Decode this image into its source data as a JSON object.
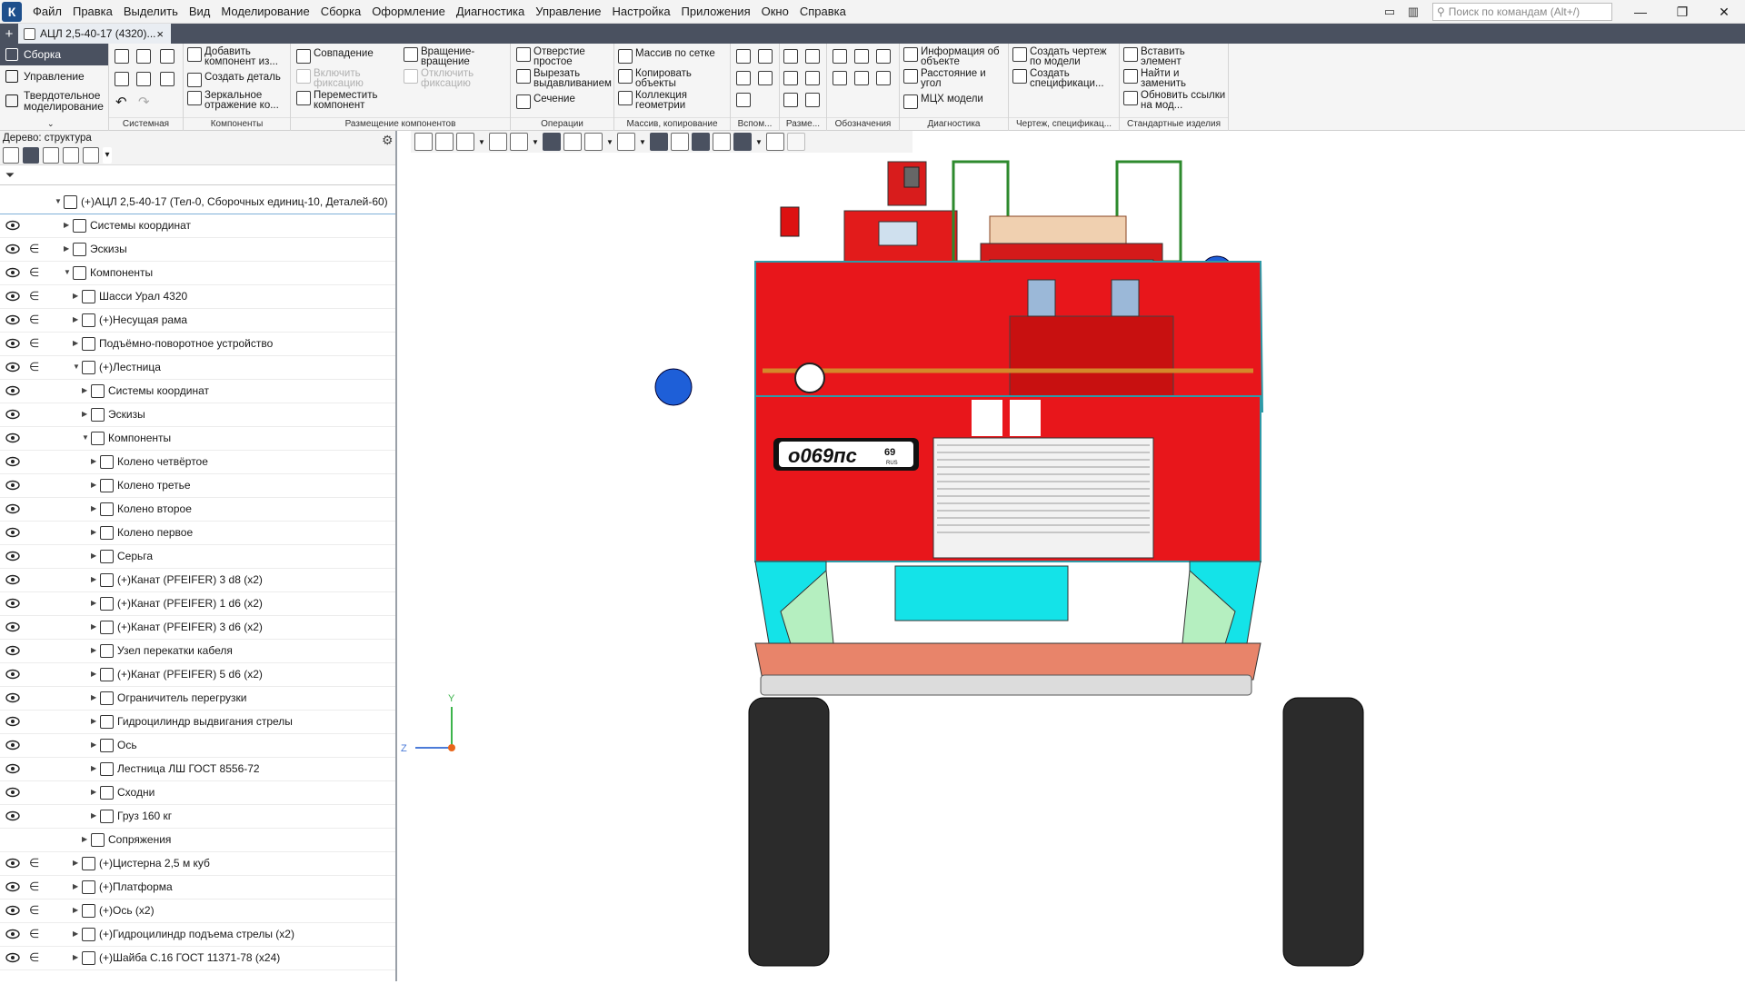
{
  "app": {
    "menu": [
      "Файл",
      "Правка",
      "Выделить",
      "Вид",
      "Моделирование",
      "Сборка",
      "Оформление",
      "Диагностика",
      "Управление",
      "Настройка",
      "Приложения",
      "Окно",
      "Справка"
    ],
    "search_placeholder": "Поиск по командам (Alt+/)"
  },
  "tab": {
    "title": "АЦЛ 2,5-40-17 (4320)...",
    "close": "×",
    "new": "+"
  },
  "ribbon": {
    "modes": [
      "Сборка",
      "Управление",
      "Твердотельное моделирование"
    ],
    "groups": {
      "system": "Системная",
      "components": "Компоненты",
      "placement": "Размещение компонентов",
      "operations": "Операции",
      "array": "Массив, копирование",
      "aux": "Вспом...",
      "dims": "Разме...",
      "marks": "Обозначения",
      "diag": "Диагностика",
      "drawing": "Чертеж, спецификац...",
      "std": "Стандартные изделия"
    },
    "buttons": {
      "add_component": "Добавить компонент из...",
      "create_part": "Создать деталь",
      "mirror": "Зеркальное отражение ко...",
      "coincidence": "Совпадение",
      "include_fix": "Включить фиксацию",
      "move_component": "Переместить компонент",
      "rotation": "Вращение-вращение",
      "disable_fix": "Отключить фиксацию",
      "hole": "Отверстие простое",
      "cut_extrude": "Вырезать выдавливанием",
      "section": "Сечение",
      "array_grid": "Массив по сетке",
      "copy_objects": "Копировать объекты",
      "geom_collection": "Коллекция геометрии",
      "info_object": "Информация об объекте",
      "dist_angle": "Расстояние и угол",
      "mch_model": "МЦХ модели",
      "create_drawing": "Создать чертеж по модели",
      "create_spec": "Создать спецификаци...",
      "insert_element": "Вставить элемент",
      "find_replace": "Найти и заменить",
      "update_links": "Обновить ссылки на мод..."
    }
  },
  "tree": {
    "title": "Дерево: структура",
    "search_placeholder": "",
    "rows": [
      {
        "label": "(+)АЦЛ 2,5-40-17 (Тел-0, Сборочных единиц-10, Деталей-60)",
        "level": 0,
        "eye": false,
        "inc": false
      },
      {
        "label": "Системы координат",
        "level": 1,
        "eye": true,
        "inc": false
      },
      {
        "label": "Эскизы",
        "level": 1,
        "eye": true,
        "inc": true
      },
      {
        "label": "Компоненты",
        "level": 1,
        "eye": true,
        "inc": true,
        "open": true
      },
      {
        "label": "Шасси Урал 4320",
        "level": 2,
        "eye": true,
        "inc": true
      },
      {
        "label": "(+)Несущая рама",
        "level": 2,
        "eye": true,
        "inc": true
      },
      {
        "label": "Подъёмно-поворотное  устройство",
        "level": 2,
        "eye": true,
        "inc": true
      },
      {
        "label": "(+)Лестница",
        "level": 2,
        "eye": true,
        "inc": true,
        "open": true
      },
      {
        "label": "Системы координат",
        "level": 3,
        "eye": true,
        "inc": false
      },
      {
        "label": "Эскизы",
        "level": 3,
        "eye": true,
        "inc": false
      },
      {
        "label": "Компоненты",
        "level": 3,
        "eye": true,
        "inc": false,
        "open": true
      },
      {
        "label": "Колено четвёртое",
        "level": 4,
        "eye": true,
        "inc": false
      },
      {
        "label": "Колено третье",
        "level": 4,
        "eye": true,
        "inc": false
      },
      {
        "label": "Колено второе",
        "level": 4,
        "eye": true,
        "inc": false
      },
      {
        "label": "Колено первое",
        "level": 4,
        "eye": true,
        "inc": false
      },
      {
        "label": "Серьга",
        "level": 4,
        "eye": true,
        "inc": false
      },
      {
        "label": "(+)Канат (PFEIFER) 3 d8 (x2)",
        "level": 4,
        "eye": true,
        "inc": false
      },
      {
        "label": "(+)Канат (PFEIFER) 1 d6 (x2)",
        "level": 4,
        "eye": true,
        "inc": false
      },
      {
        "label": "(+)Канат (PFEIFER) 3 d6 (x2)",
        "level": 4,
        "eye": true,
        "inc": false
      },
      {
        "label": "Узел перекатки кабеля",
        "level": 4,
        "eye": true,
        "inc": false
      },
      {
        "label": "(+)Канат (PFEIFER) 5 d6 (x2)",
        "level": 4,
        "eye": true,
        "inc": false
      },
      {
        "label": "Ограничитель перегрузки",
        "level": 4,
        "eye": true,
        "inc": false
      },
      {
        "label": "Гидроцилиндр выдвигания стрелы",
        "level": 4,
        "eye": true,
        "inc": false
      },
      {
        "label": "Ось",
        "level": 4,
        "eye": true,
        "inc": false
      },
      {
        "label": "Лестница ЛШ ГОСТ 8556-72",
        "level": 4,
        "eye": true,
        "inc": false
      },
      {
        "label": "Сходни",
        "level": 4,
        "eye": true,
        "inc": false
      },
      {
        "label": "Груз 160 кг",
        "level": 4,
        "eye": true,
        "inc": false
      },
      {
        "label": "Сопряжения",
        "level": 3,
        "eye": false,
        "inc": false
      },
      {
        "label": "(+)Цистерна 2,5 м куб",
        "level": 2,
        "eye": true,
        "inc": true
      },
      {
        "label": "(+)Платформа",
        "level": 2,
        "eye": true,
        "inc": true
      },
      {
        "label": "(+)Ось  (x2)",
        "level": 2,
        "eye": true,
        "inc": true
      },
      {
        "label": "(+)Гидроцилиндр подъема стрелы (x2)",
        "level": 2,
        "eye": true,
        "inc": true
      },
      {
        "label": "(+)Шайба С.16 ГОСТ 11371-78 (x24)",
        "level": 2,
        "eye": true,
        "inc": true
      }
    ]
  },
  "viewport": {
    "plate_number": "о069пс",
    "plate_region": "69",
    "plate_country": "RUS",
    "axis_y": "Y",
    "axis_z": "Z"
  },
  "colors": {
    "accent_dark": "#4a5160",
    "truck_red": "#e8161b",
    "cyan": "#14e3e8",
    "tree_link": "#7fb0d8"
  }
}
